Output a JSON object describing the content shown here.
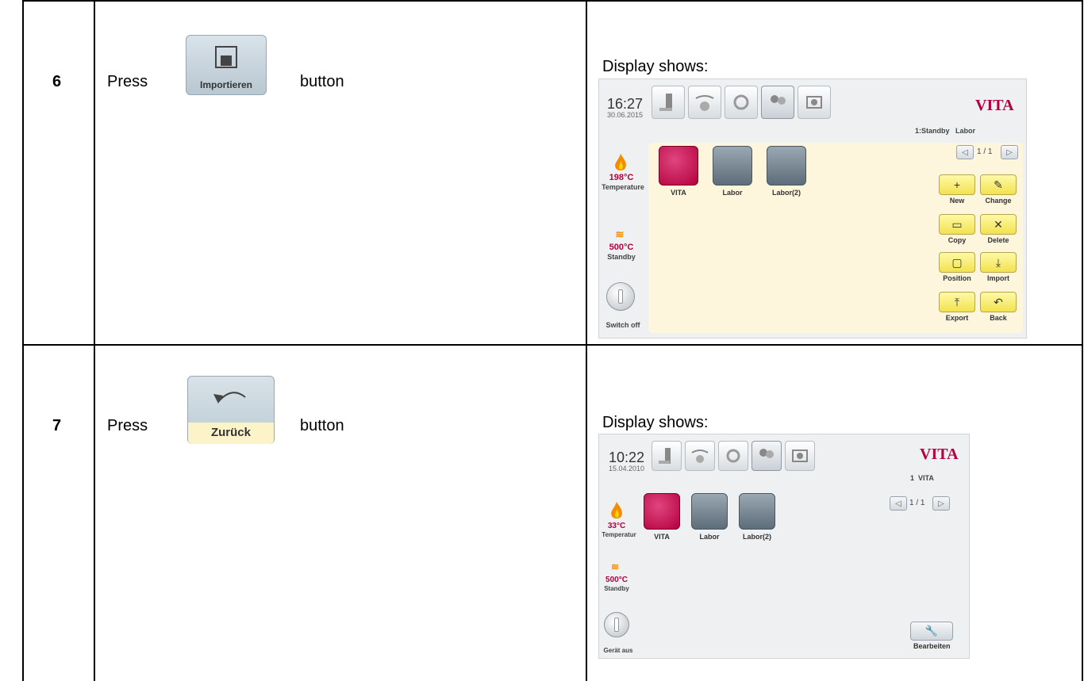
{
  "rows": [
    {
      "step": "6",
      "instruction": {
        "press": "Press",
        "button_label": "Importieren",
        "button_word": "button"
      },
      "display_caption": "Display shows:",
      "screen": {
        "time": "16:27",
        "date": "30.06.2015",
        "brand": "VITA",
        "status": "1:Standby",
        "user": "Labor",
        "temperature_value": "198°C",
        "temperature_label": "Temperature",
        "standby_value": "500°C",
        "standby_label": "Standby",
        "switch_label": "Switch off",
        "page": "1 / 1",
        "programs": [
          "VITA",
          "Labor",
          "Labor(2)"
        ],
        "actions": [
          "New",
          "Change",
          "Copy",
          "Delete",
          "Position",
          "Import",
          "Export",
          "Back"
        ]
      }
    },
    {
      "step": "7",
      "instruction": {
        "press": "Press",
        "button_label": "Zurück",
        "button_word": "button"
      },
      "display_caption": "Display shows:",
      "screen": {
        "time": "10:22",
        "date": "15.04.2010",
        "brand": "VITA",
        "status": "1",
        "user": "VITA",
        "temperature_value": "33°C",
        "temperature_label": "Temperatur",
        "standby_value": "500°C",
        "standby_label": "Standby",
        "switch_label": "Gerät aus",
        "page": "1 / 1",
        "programs": [
          "VITA",
          "Labor",
          "Labor(2)"
        ],
        "edit_label": "Bearbeiten"
      }
    }
  ],
  "colors": {
    "brand": "#b3003c",
    "panel": "#fdf5dc",
    "action_yellow": "#f2e24f"
  },
  "icons": [
    "furnace-tab-icon",
    "firing-tab-icon",
    "settings-tab-icon",
    "users-tab-icon",
    "camera-tab-icon",
    "flame-icon",
    "heat-icon",
    "power-icon",
    "wrench-icon"
  ]
}
